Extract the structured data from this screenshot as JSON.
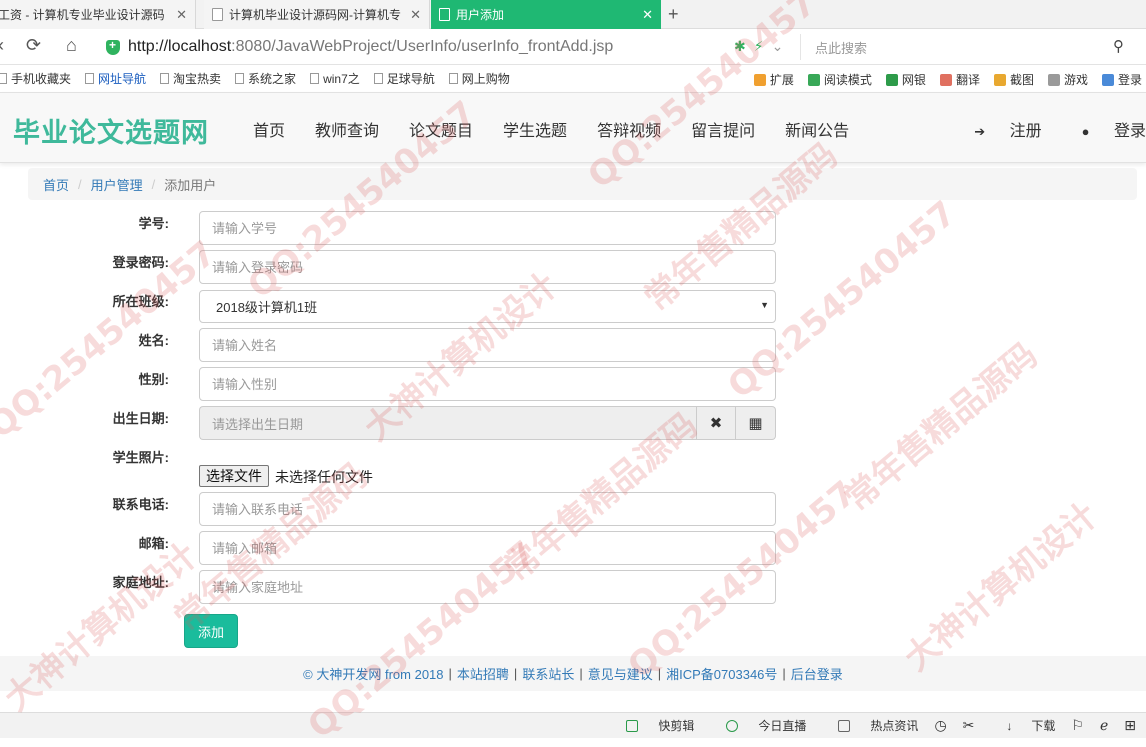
{
  "browser": {
    "tabs": [
      {
        "title": "工资 - 计算机专业毕业设计源码",
        "active": false
      },
      {
        "title": "计算机毕业设计源码网-计算机专",
        "active": false
      },
      {
        "title": "用户添加",
        "active": true
      }
    ],
    "url_host": "http://localhost",
    "url_rest": ":8080/JavaWebProject/UserInfo/userInfo_frontAdd.jsp",
    "search_placeholder": "点此搜索",
    "bookmarks": [
      "手机收藏夹",
      "网址导航",
      "淘宝热卖",
      "系统之家",
      "win7之",
      "足球导航",
      "网上购物"
    ],
    "toolbar_right": [
      "扩展",
      "阅读模式",
      "网银",
      "翻译",
      "截图",
      "游戏",
      "登录"
    ],
    "statusbar": [
      "快剪辑",
      "今日直播",
      "热点资讯",
      "下载"
    ]
  },
  "site": {
    "brand": "毕业论文选题网",
    "menu": [
      "首页",
      "教师查询",
      "论文题目",
      "学生选题",
      "答辩视频",
      "留言提问",
      "新闻公告"
    ],
    "register": "注册",
    "login": "登录"
  },
  "breadcrumb": {
    "home": "首页",
    "section": "用户管理",
    "current": "添加用户"
  },
  "form": {
    "student_no": {
      "label": "学号:",
      "placeholder": "请输入学号"
    },
    "password": {
      "label": "登录密码:",
      "placeholder": "请输入登录密码"
    },
    "class": {
      "label": "所在班级:",
      "value": "2018级计算机1班"
    },
    "name": {
      "label": "姓名:",
      "placeholder": "请输入姓名"
    },
    "gender": {
      "label": "性别:",
      "placeholder": "请输入性别"
    },
    "birthday": {
      "label": "出生日期:",
      "placeholder": "请选择出生日期"
    },
    "photo": {
      "label": "学生照片:",
      "button": "选择文件",
      "status": "未选择任何文件"
    },
    "phone": {
      "label": "联系电话:",
      "placeholder": "请输入联系电话"
    },
    "email": {
      "label": "邮箱:",
      "placeholder": "请输入邮箱"
    },
    "address": {
      "label": "家庭地址:",
      "placeholder": "请输入家庭地址"
    },
    "submit": "添加"
  },
  "footer": [
    "© 大神开发网 from 2018",
    "本站招聘",
    "联系站长",
    "意见与建议",
    "湘ICP备0703346号",
    "后台登录"
  ],
  "watermark": [
    "QQ:254540457",
    "常年售精品源码",
    "大神计算机设计"
  ]
}
